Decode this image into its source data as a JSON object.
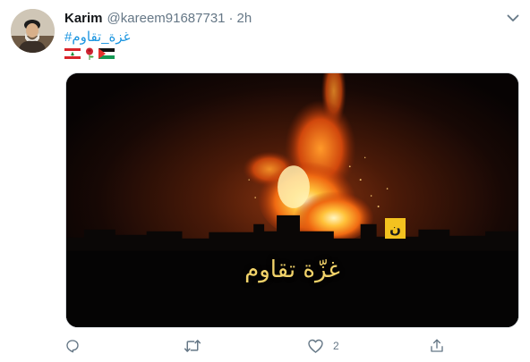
{
  "tweet": {
    "display_name": "Karim",
    "handle": "@kareem91687731",
    "separator": "·",
    "timestamp": "2h",
    "hashtag": "#غزة_تقاوم",
    "emojis": [
      "lebanon-flag",
      "rose",
      "palestine-flag"
    ],
    "media": {
      "overlay_text": "غزّة تقاوم",
      "logo_text": "ن"
    },
    "actions": {
      "reply_count": "",
      "retweet_count": "",
      "like_count": "2",
      "share_count": ""
    }
  },
  "colors": {
    "link": "#1b95e0",
    "secondary_text": "#657786",
    "primary_text": "#14171a",
    "overlay_text": "#f2d36a",
    "logo_bg": "#f4c21f"
  }
}
